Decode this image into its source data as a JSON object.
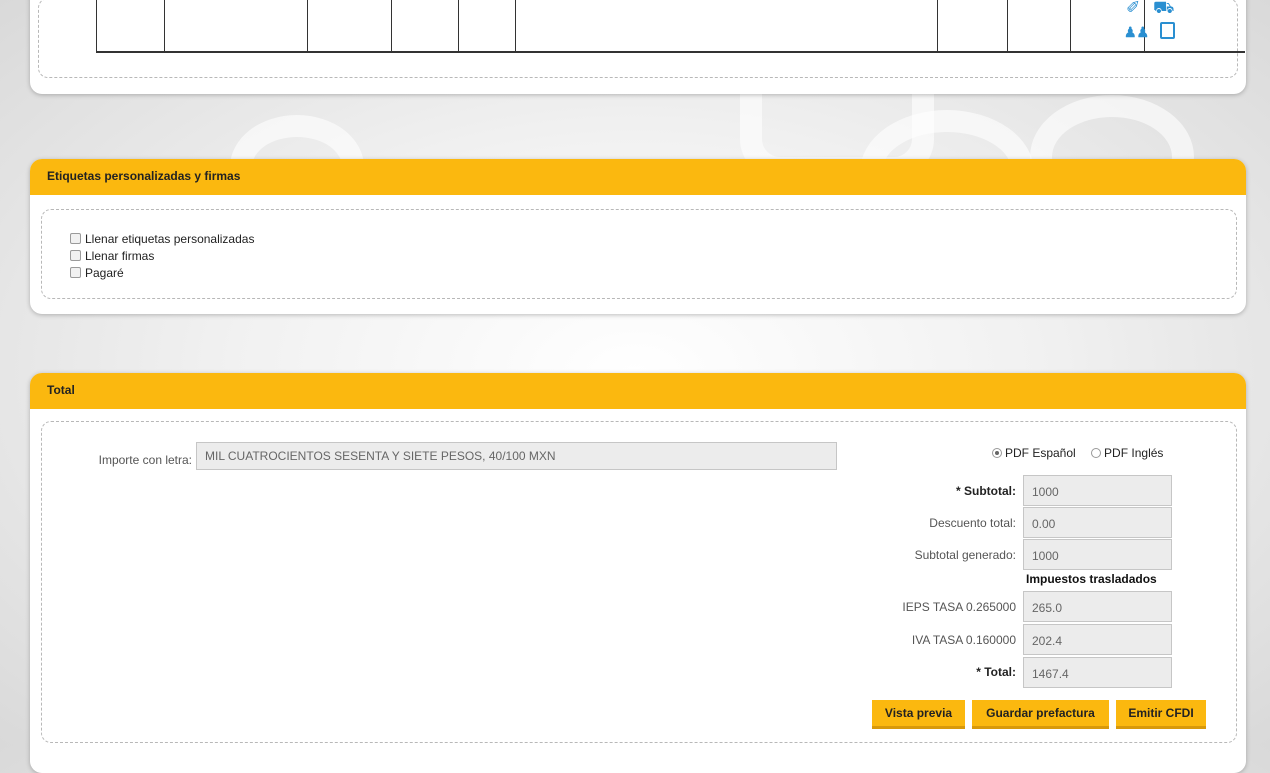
{
  "etiquetas": {
    "title": "Etiquetas personalizadas y firmas",
    "options": [
      "Llenar etiquetas personalizadas",
      "Llenar firmas",
      "Pagaré"
    ]
  },
  "total": {
    "title": "Total",
    "importe_label": "Importe con letra:",
    "importe_value": "MIL CUATROCIENTOS SESENTA Y SIETE PESOS, 40/100 MXN",
    "pdf_es": "PDF Español",
    "pdf_en": "PDF Inglés",
    "subtotal_label": "* Subtotal:",
    "subtotal_value": "1000",
    "descuento_label": "Descuento total:",
    "descuento_value": "0.00",
    "subtotal_gen_label": "Subtotal generado:",
    "subtotal_gen_value": "1000",
    "impuestos_heading": "Impuestos trasladados",
    "ieps_label": "IEPS TASA 0.265000",
    "ieps_value": "265.0",
    "iva_label": "IVA TASA 0.160000",
    "iva_value": "202.4",
    "total_label": "* Total:",
    "total_value": "1467.4"
  },
  "buttons": {
    "vista_previa": "Vista previa",
    "guardar": "Guardar prefactura",
    "emitir": "Emitir CFDI"
  }
}
